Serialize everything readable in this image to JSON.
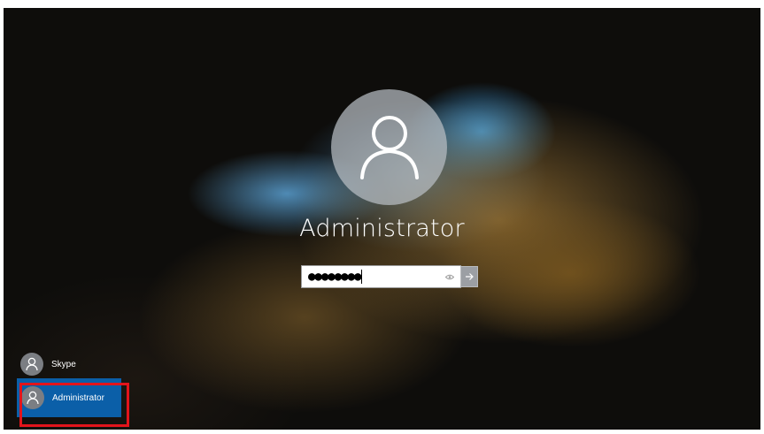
{
  "lock_screen": {
    "username": "Administrator",
    "password": {
      "masked_value": "●●●●●●●●",
      "reveal_icon": "eye-icon",
      "submit_icon": "arrow-right-icon"
    }
  },
  "user_list": [
    {
      "name": "Skype",
      "icon": "user-icon",
      "selected": false
    },
    {
      "name": "Administrator",
      "icon": "user-icon",
      "selected": true
    }
  ],
  "colors": {
    "selected_user_bg": "#0b5fa8",
    "highlight_border": "#e3141b",
    "avatar_bg": "#b9bec4"
  }
}
